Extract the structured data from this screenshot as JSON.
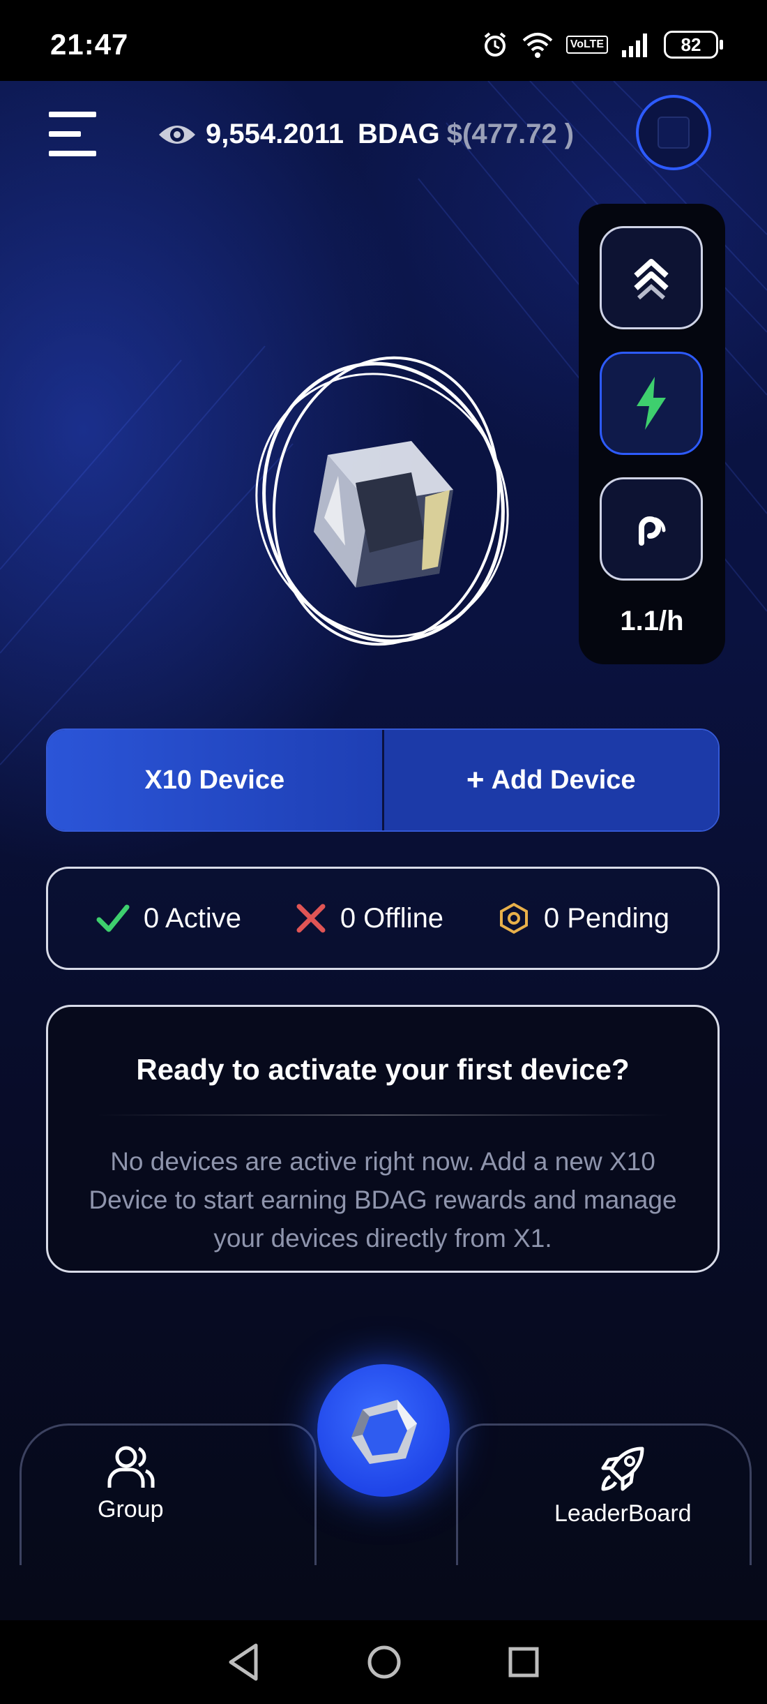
{
  "status": {
    "time": "21:47",
    "battery": "82",
    "volte": "VoLTE"
  },
  "header": {
    "menu_icon": "hamburger-icon",
    "visibility_icon": "eye-icon",
    "balance": "9,554.2011",
    "unit": "BDAG",
    "usd": "$(477.72 )"
  },
  "side_panel": {
    "buttons": [
      {
        "icon": "double-chevron-up-icon",
        "active": false
      },
      {
        "icon": "lightning-icon",
        "active": true
      },
      {
        "icon": "signal-icon",
        "active": false
      }
    ],
    "rate": "1.1/h"
  },
  "device_toggle": {
    "left_label": "X10 Device",
    "right_label": "Add Device",
    "right_icon": "plus-icon"
  },
  "device_stats": {
    "active": "0 Active",
    "offline": "0 Offline",
    "pending": "0 Pending",
    "colors": {
      "active": "#3ecf6e",
      "offline": "#e05555",
      "pending": "#e8b04a"
    }
  },
  "info_card": {
    "title": "Ready to activate your first device?",
    "body": "No devices are active right now. Add a new X10 Device to start earning BDAG rewards and manage your devices directly from X1."
  },
  "bottom_nav": {
    "left": {
      "label": "Group",
      "icon": "group-icon"
    },
    "center": {
      "icon": "cube-icon"
    },
    "right": {
      "label": "LeaderBoard",
      "icon": "rocket-icon"
    }
  },
  "colors": {
    "accent": "#2d5bff",
    "background": "#0a1240"
  }
}
